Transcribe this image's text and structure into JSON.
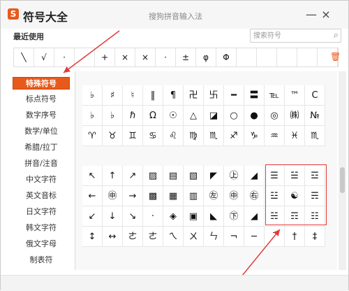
{
  "app": {
    "title": "符号大全",
    "subtitle": "搜狗拼音输入法",
    "logo_text": "S",
    "minimize_label": "—",
    "close_label": "×"
  },
  "recent": {
    "label": "最近使用",
    "symbols": [
      "╲",
      "√",
      "·",
      "·",
      "+",
      "×",
      "×",
      "·",
      "±",
      "φ",
      "Φ",
      "",
      "",
      "",
      "",
      ""
    ]
  },
  "search": {
    "placeholder": "搜索符号"
  },
  "sidebar": {
    "items": [
      {
        "label": "特殊符号",
        "active": true
      },
      {
        "label": "标点符号"
      },
      {
        "label": "数字序号"
      },
      {
        "label": "数学/单位"
      },
      {
        "label": "希腊/拉丁"
      },
      {
        "label": "拼音/注音"
      },
      {
        "label": "中文字符"
      },
      {
        "label": "英文音标"
      },
      {
        "label": "日文字符"
      },
      {
        "label": "韩文字符"
      },
      {
        "label": "俄文字母"
      },
      {
        "label": "制表符"
      }
    ]
  },
  "grid_top": [
    [
      "♭",
      "♯",
      "♮",
      "‖",
      "¶",
      "卍",
      "卐",
      "━",
      "〓",
      "℡",
      "™",
      "C"
    ],
    [
      "♭",
      "♭",
      "ℏ",
      "Ω",
      "☉",
      "△",
      "◪",
      "○",
      "●",
      "◎",
      "㈱",
      "№"
    ],
    [
      "♈",
      "♉",
      "♊",
      "♋",
      "♌",
      "♍",
      "♏",
      "♐",
      "♑",
      "♒",
      "♓",
      "♏"
    ]
  ],
  "grid_bottom": [
    [
      "↖",
      "↑",
      "↗",
      "▨",
      "▤",
      "▧",
      "◤",
      "㊤",
      "◢",
      "☰",
      "☱",
      "☲"
    ],
    [
      "←",
      "㊥",
      "→",
      "▩",
      "▦",
      "▥",
      "㊧",
      "㊥",
      "㊨",
      "☳",
      "☯",
      "☴"
    ],
    [
      "↙",
      "↓",
      "↘",
      "·",
      "◈",
      "▣",
      "◣",
      "㊦",
      "◢",
      "☵",
      "☶",
      "☷"
    ],
    [
      "↕",
      "↔",
      "ㄜ",
      "ㄜ",
      "ㄟ",
      "ㄨ",
      "ㄣ",
      "¬",
      "─",
      "¯",
      "†",
      "‡"
    ]
  ],
  "colors": {
    "accent": "#e85a1b",
    "highlight_box": "#e23b3b",
    "arrow": "#e23b3b"
  }
}
